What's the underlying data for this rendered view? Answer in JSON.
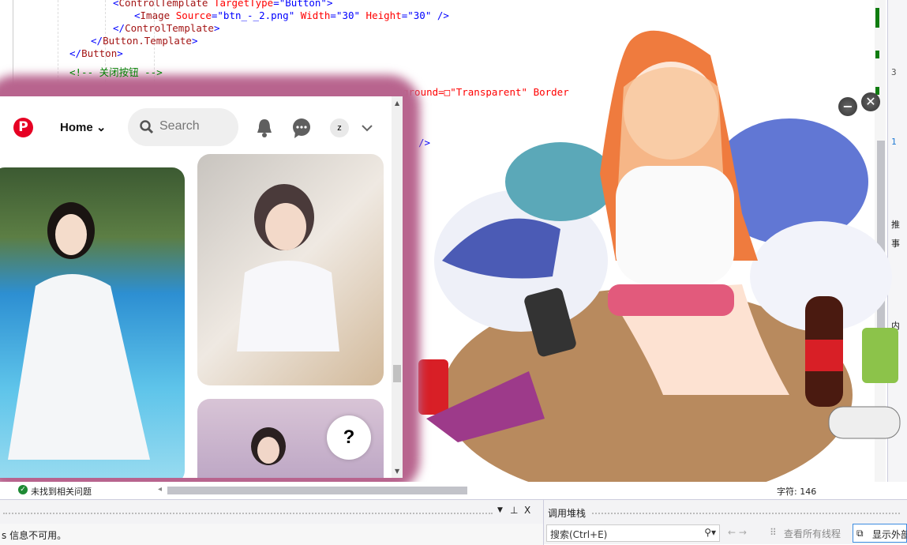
{
  "editor": {
    "lines": [
      {
        "indent": "ControlTemplate",
        "parts": [
          [
            "br",
            "<"
          ],
          [
            "tag",
            "ControlTemplate"
          ],
          [
            "at",
            " TargetType"
          ],
          [
            "br",
            "="
          ],
          [
            "val",
            "\"Button\""
          ],
          [
            "br",
            ">"
          ]
        ]
      },
      {
        "parts": [
          [
            "br",
            "<"
          ],
          [
            "tag",
            "Image"
          ],
          [
            "at",
            " Source"
          ],
          [
            "br",
            "="
          ],
          [
            "val",
            "\"btn_-_2.png\""
          ],
          [
            "at",
            " Width"
          ],
          [
            "br",
            "="
          ],
          [
            "val",
            "\"30\""
          ],
          [
            "at",
            " Height"
          ],
          [
            "br",
            "="
          ],
          [
            "val",
            "\"30\""
          ],
          [
            "br",
            " />"
          ]
        ]
      },
      {
        "parts": [
          [
            "br",
            "</"
          ],
          [
            "tag",
            "ControlTemplate"
          ],
          [
            "br",
            ">"
          ]
        ]
      },
      {
        "parts": [
          [
            "br",
            "</"
          ],
          [
            "tag",
            "Button.Template"
          ],
          [
            "br",
            ">"
          ]
        ]
      },
      {
        "parts": [
          [
            "br",
            "</"
          ],
          [
            "tag",
            "Button"
          ],
          [
            "br",
            ">"
          ]
        ]
      }
    ],
    "comment": "<!-- 关闭按钮 -->",
    "partial_line": "ground=□\"Transparent\" Border",
    "partial_close": "/>",
    "partial_template": "</Button.Template>"
  },
  "pinterest": {
    "logo": "P",
    "home_label": "Home",
    "search_placeholder": "Search",
    "avatar_letter": "z",
    "help_label": "?",
    "brand_color": "#e60023",
    "frame_color": "#b8648e"
  },
  "status": {
    "issues": "未找到相关问题",
    "chars": "字符: 146"
  },
  "bottom": {
    "output_text": "s 信息不可用。",
    "callstack_title": "调用堆栈",
    "search_placeholder": "搜索(Ctrl+E)",
    "view_all_threads": "查看所有线程",
    "show_external": "显示外部",
    "pin": "⊥",
    "close": "X"
  },
  "sidebar": {
    "r1": "3",
    "r2": "1",
    "r3": "推",
    "r4": "事",
    "r5": "内"
  },
  "overlay": {
    "minimize": "−",
    "close": "✕"
  }
}
